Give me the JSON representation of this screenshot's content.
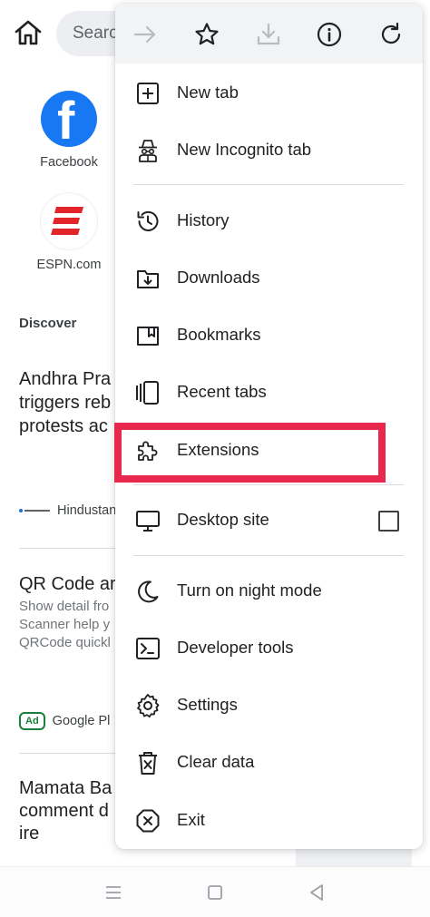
{
  "background": {
    "search_placeholder": "Searc",
    "shortcuts": [
      {
        "label": "Facebook",
        "icon": "facebook-logo"
      },
      {
        "label": "ESPN.com",
        "icon": "espn-logo"
      }
    ],
    "discover_label": "Discover",
    "articles": [
      {
        "lines": [
          "Andhra Pra",
          "triggers reb",
          "protests ac"
        ],
        "source": "Hindustan"
      },
      {
        "lines": [
          "QR Code ar"
        ],
        "sub": [
          "Show detail fro",
          "Scanner help y",
          "QRCode quickl"
        ],
        "ad_badge": "Ad",
        "source": "Google Pl"
      },
      {
        "lines": [
          "Mamata Ba",
          "comment d",
          "ire"
        ]
      }
    ]
  },
  "menu": {
    "toolbar_icons": [
      "forward-icon",
      "star-icon",
      "download-icon",
      "info-icon",
      "refresh-icon"
    ],
    "items": [
      {
        "label": "New tab",
        "icon": "plus-box-icon"
      },
      {
        "label": "New Incognito tab",
        "icon": "incognito-icon"
      },
      {
        "label": "History",
        "icon": "history-icon"
      },
      {
        "label": "Downloads",
        "icon": "downloads-icon"
      },
      {
        "label": "Bookmarks",
        "icon": "bookmarks-icon"
      },
      {
        "label": "Recent tabs",
        "icon": "recent-tabs-icon"
      },
      {
        "label": "Extensions",
        "icon": "puzzle-icon",
        "highlighted": true
      },
      {
        "label": "Desktop site",
        "icon": "monitor-icon",
        "checked": false
      },
      {
        "label": "Turn on night mode",
        "icon": "moon-icon"
      },
      {
        "label": "Developer tools",
        "icon": "terminal-icon"
      },
      {
        "label": "Settings",
        "icon": "gear-icon"
      },
      {
        "label": "Clear data",
        "icon": "trash-icon"
      },
      {
        "label": "Exit",
        "icon": "exit-icon"
      }
    ]
  },
  "colors": {
    "highlight": "#e8284c",
    "menu_header": "#f1f3f4",
    "facebook": "#1877f2",
    "espn": "#e2242b",
    "ad_green": "#188038"
  }
}
